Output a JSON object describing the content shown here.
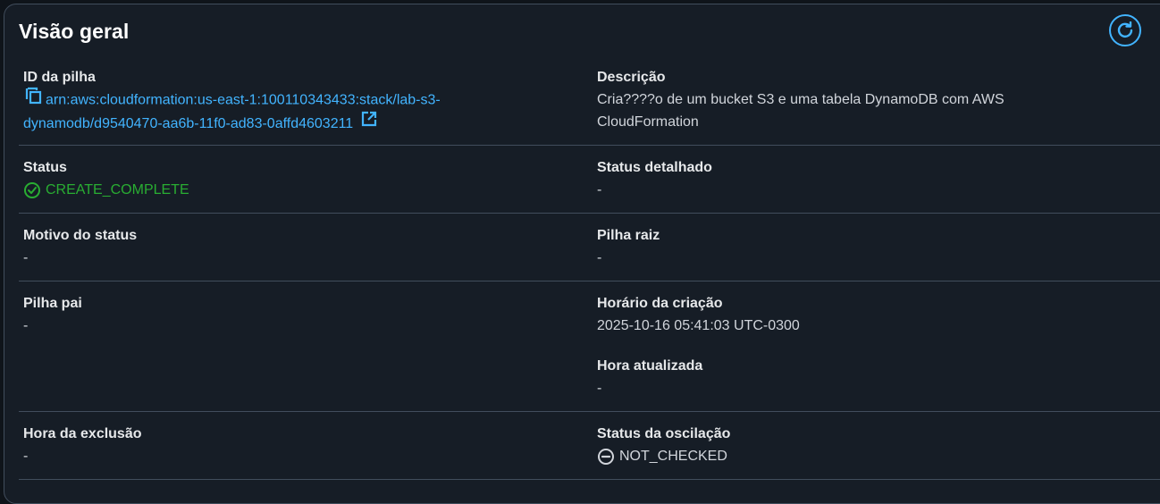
{
  "overview": {
    "title": "Visão geral",
    "refresh_icon": "refresh-icon"
  },
  "fields": {
    "stack_id": {
      "label": "ID da pilha",
      "value_line1": "arn:aws:cloudformation:us-east-1:100110343433:stack/lab-s3-",
      "value_line2": "dynamodb/d9540470-aa6b-11f0-ad83-0affd4603211",
      "copy_icon": "copy-icon",
      "external_icon": "external-link-icon"
    },
    "description": {
      "label": "Descrição",
      "value_line1": "Cria????o de um bucket S3 e uma tabela DynamoDB com AWS",
      "value_line2": "CloudFormation"
    },
    "status": {
      "label": "Status",
      "value": "CREATE_COMPLETE",
      "icon": "success-check-icon",
      "color": "#29ad32"
    },
    "detailed_status": {
      "label": "Status detalhado",
      "value": "-"
    },
    "status_reason": {
      "label": "Motivo do status",
      "value": "-"
    },
    "root_stack": {
      "label": "Pilha raiz",
      "value": "-"
    },
    "parent_stack": {
      "label": "Pilha pai",
      "value": "-"
    },
    "creation_time": {
      "label": "Horário da criação",
      "value": "2025-10-16 05:41:03 UTC-0300"
    },
    "updated_time": {
      "label": "Hora atualizada",
      "value": "-"
    },
    "deletion_time": {
      "label": "Hora da exclusão",
      "value": "-"
    },
    "drift_status": {
      "label": "Status da oscilação",
      "value": "NOT_CHECKED",
      "icon": "not-checked-icon"
    }
  },
  "colors": {
    "link": "#42b4ff",
    "success": "#29ad32",
    "background": "#161d26",
    "border": "#414d5c"
  }
}
